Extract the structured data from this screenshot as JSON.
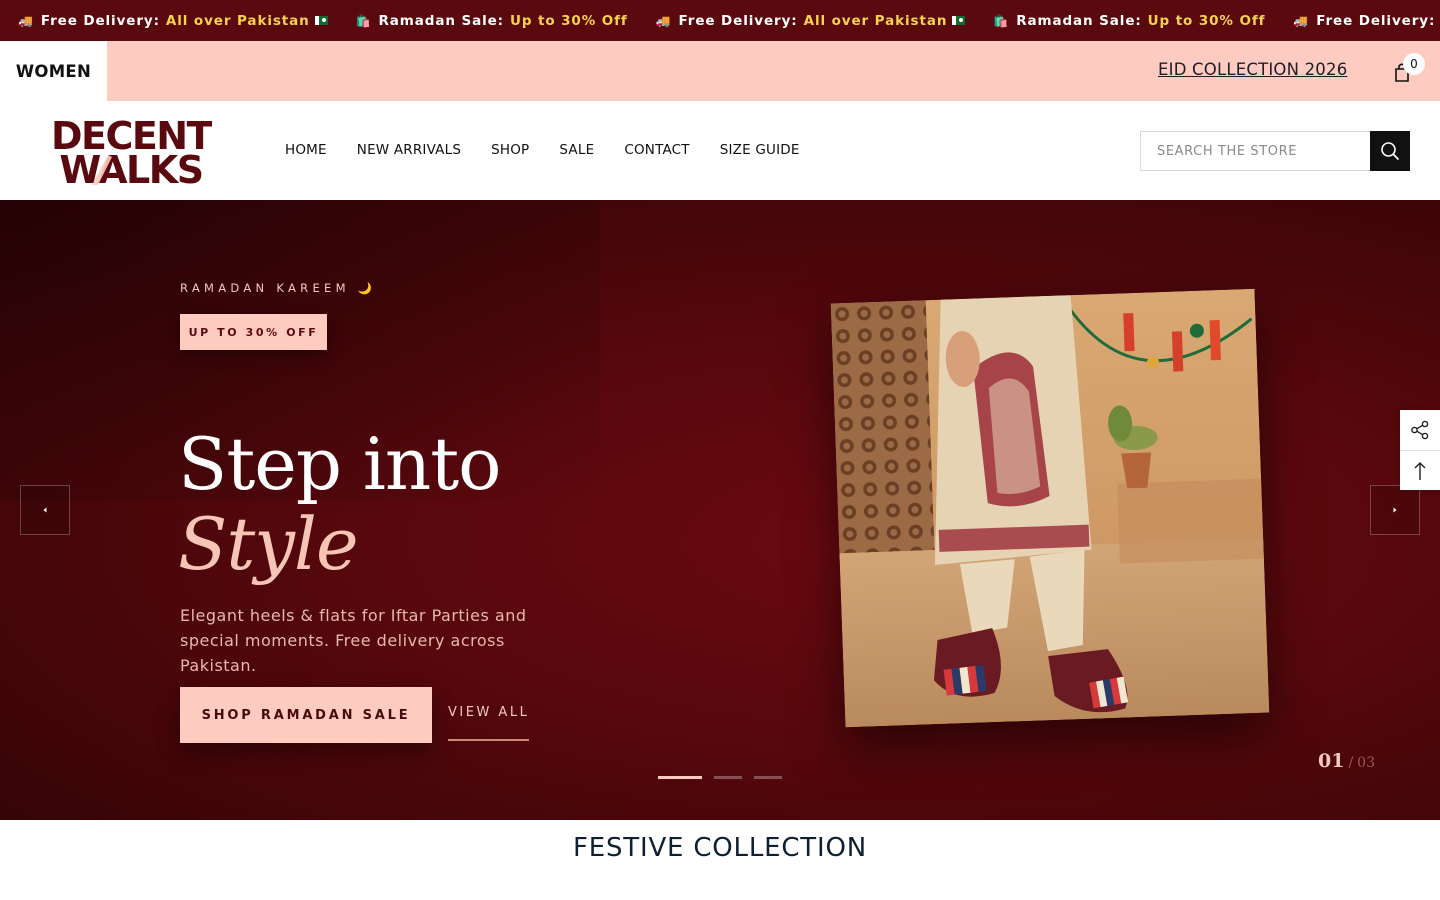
{
  "announcement": {
    "items": [
      {
        "emoji": "🚚",
        "label": "Free Delivery:",
        "highlight": "All over Pakistan",
        "flag": true
      },
      {
        "emoji": "🛍️",
        "label": "Ramadan Sale:",
        "highlight": "Up to 30% Off",
        "flag": false
      },
      {
        "emoji": "🚚",
        "label": "Free Delivery:",
        "highlight": "All over Pakistan",
        "flag": true
      },
      {
        "emoji": "🛍️",
        "label": "Ramadan Sale:",
        "highlight": "Up to 30% Off",
        "flag": false
      },
      {
        "emoji": "🚚",
        "label": "Free Delivery:",
        "highlight": "All over Pakistan",
        "flag": true
      }
    ]
  },
  "topbar": {
    "category": "WOMEN",
    "collection_link": "EID COLLECTION 2026",
    "cart_count": "0"
  },
  "header": {
    "logo_line1": "DECENT",
    "logo_line2": "WALKS",
    "nav": [
      "HOME",
      "NEW ARRIVALS",
      "SHOP",
      "SALE",
      "CONTACT",
      "SIZE GUIDE"
    ],
    "search_placeholder": "SEARCH THE STORE"
  },
  "hero": {
    "eyebrow": "RAMADAN KAREEM 🌙",
    "badge": "UP TO 30% OFF",
    "headline_line1": "Step into",
    "headline_line2": "Style",
    "subtext": "Elegant heels & flats for Iftar Parties and special moments. Free delivery across Pakistan.",
    "cta_label": "SHOP RAMADAN SALE",
    "secondary_label": "VIEW ALL",
    "slide_current": "01",
    "slide_separator": "/",
    "slide_total": "03",
    "slide_index": 1,
    "slide_count": 3
  },
  "section": {
    "title": "FESTIVE COLLECTION"
  },
  "colors": {
    "announcement_bg": "#5a0a0e",
    "highlight": "#f5d34a",
    "peach": "#fdcbbf",
    "hero_bg": "#58080d",
    "logo": "#5a0a0e"
  },
  "icons": {
    "cart": "shopping-bag-icon",
    "search": "search-icon",
    "prev": "chevron-left-icon",
    "next": "chevron-right-icon",
    "share": "share-icon",
    "top": "arrow-up-icon"
  }
}
